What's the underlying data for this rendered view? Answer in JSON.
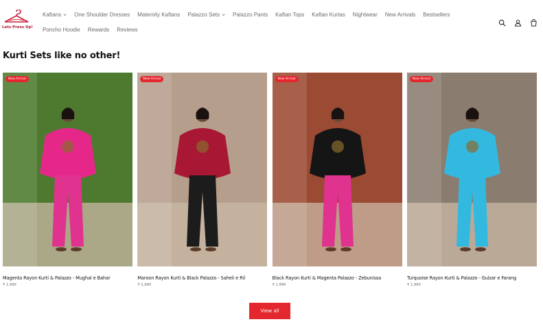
{
  "brand": {
    "logo_text": "Lets Press Up!",
    "accent": "#e4272e"
  },
  "nav": {
    "row1": [
      {
        "label": "Kaftans",
        "has_dropdown": true
      },
      {
        "label": "One Shoulder Dresses",
        "has_dropdown": false
      },
      {
        "label": "Maternity Kaftans",
        "has_dropdown": false
      },
      {
        "label": "Palazzo Sets",
        "has_dropdown": true
      },
      {
        "label": "Palazzo Pants",
        "has_dropdown": false
      },
      {
        "label": "Kaftan Tops",
        "has_dropdown": false
      },
      {
        "label": "Kaftan Kurtas",
        "has_dropdown": false
      },
      {
        "label": "Nightwear",
        "has_dropdown": false
      },
      {
        "label": "New Arrivals",
        "has_dropdown": false
      },
      {
        "label": "Bestsellers",
        "has_dropdown": false
      }
    ],
    "row2": [
      {
        "label": "Poncho Hoodie"
      },
      {
        "label": "Rewards"
      },
      {
        "label": "Reviews"
      }
    ]
  },
  "header_icons": [
    "search-icon",
    "account-icon",
    "cart-icon"
  ],
  "section": {
    "title": "Kurti Sets like no other!"
  },
  "products": [
    {
      "badge": "New Arrival",
      "name": "Magenta Rayon Kurti & Palazzo - Mughal e Bahar",
      "price": "₹ 1,990",
      "top_color": "#e6278a",
      "bottom_color": "#e0338f",
      "bg": "#4d7a2e"
    },
    {
      "badge": "New Arrival",
      "name": "Maroon Rayon Kurti & Black Palazzo - Saheli e Ril",
      "price": "₹ 1,990",
      "top_color": "#a81834",
      "bottom_color": "#1c1c1c",
      "bg": "#b59e8c"
    },
    {
      "badge": "New Arrival",
      "name": "Black Rayon Kurti & Magenta Palazzo - Zebunissa",
      "price": "₹ 1,990",
      "top_color": "#151515",
      "bottom_color": "#e0338f",
      "bg": "#9b4a33"
    },
    {
      "badge": "New Arrival",
      "name": "Turquoise Rayon Kurti & Palazzo - Gulzar e Farang",
      "price": "₹ 1,990",
      "top_color": "#33b9df",
      "bottom_color": "#33b9df",
      "bg": "#8a7c6e"
    }
  ],
  "view_all_label": "View all"
}
